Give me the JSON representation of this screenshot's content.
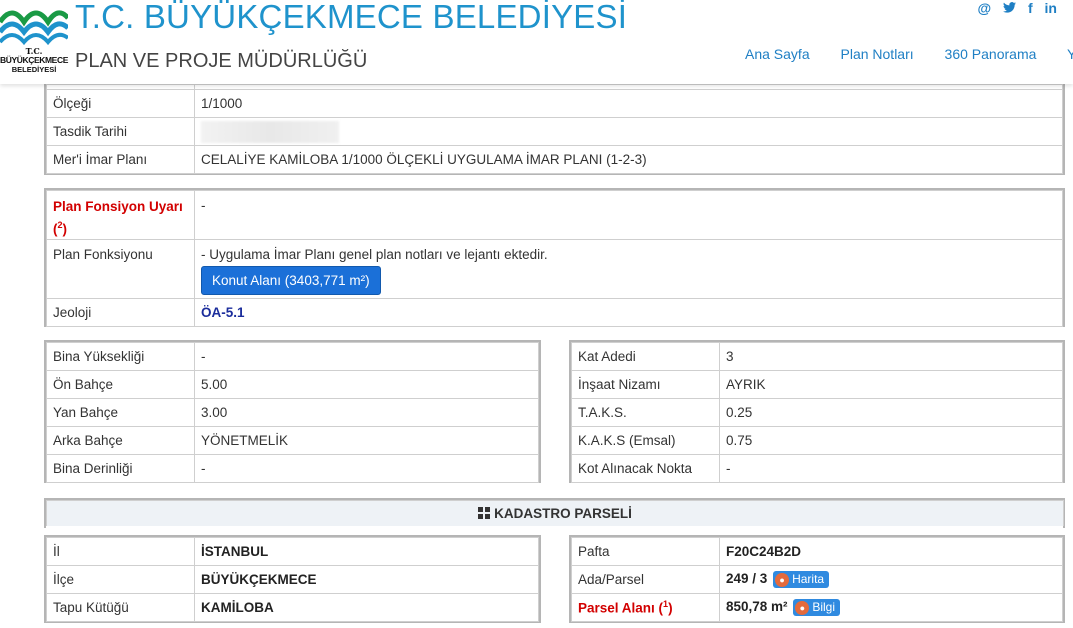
{
  "header": {
    "title": "T.C. BÜYÜKÇEKMECE BELEDİYESİ",
    "subtitle": "PLAN VE PROJE MÜDÜRLÜĞÜ",
    "logo": {
      "line1": "T.C.",
      "line2": "BÜYÜKÇEKMECE",
      "line3": "BELEDİYESİ"
    },
    "social": {
      "email": "@",
      "twitter": "twitter-icon",
      "facebook": "f",
      "linkedin": "in"
    },
    "nav": [
      "Ana Sayfa",
      "Plan Notları",
      "360 Panorama",
      "Y"
    ]
  },
  "plan_info": {
    "rows": [
      {
        "label": "Ölçeği",
        "value": "1/1000"
      },
      {
        "label": "Tasdik Tarihi",
        "value": ""
      },
      {
        "label": "Mer'i İmar Planı",
        "value": "CELALİYE KAMİLOBA 1/1000 ÖLÇEKLİ UYGULAMA İMAR PLANI (1-2-3)"
      }
    ]
  },
  "function": {
    "warning_label": "Plan Fonsiyon Uyarı",
    "warning_ref": "2",
    "warning_value": "-",
    "function_label": "Plan Fonksiyonu",
    "function_note": "- Uygulama İmar Planı genel plan notları ve lejantı ektedir.",
    "function_button": "Konut Alanı (3403,771 m²)",
    "geology_label": "Jeoloji",
    "geology_value": "ÖA-5.1"
  },
  "building_left": [
    {
      "label": "Bina Yüksekliği",
      "value": "-"
    },
    {
      "label": "Ön Bahçe",
      "value": "5.00"
    },
    {
      "label": "Yan Bahçe",
      "value": "3.00"
    },
    {
      "label": "Arka Bahçe",
      "value": "YÖNETMELİK"
    },
    {
      "label": "Bina Derinliği",
      "value": "-"
    }
  ],
  "building_right": [
    {
      "label": "Kat Adedi",
      "value": "3"
    },
    {
      "label": "İnşaat Nizamı",
      "value": "AYRIK"
    },
    {
      "label": "T.A.K.S.",
      "value": "0.25"
    },
    {
      "label": "K.A.K.S (Emsal)",
      "value": "0.75"
    },
    {
      "label": "Kot Alınacak Nokta",
      "value": "-"
    }
  ],
  "cadastre": {
    "heading": "KADASTRO PARSELİ",
    "left": [
      {
        "label": "İl",
        "value": "İSTANBUL"
      },
      {
        "label": "İlçe",
        "value": "BÜYÜKÇEKMECE"
      },
      {
        "label": "Tapu Kütüğü",
        "value": "KAMİLOBA"
      }
    ],
    "pafta_label": "Pafta",
    "pafta_value": "F20C24B2D",
    "ada_label": "Ada/Parsel",
    "ada_value": "249 / 3",
    "map_button": "Harita",
    "area_label": "Parsel Alanı",
    "area_ref": "1",
    "area_value": "850,78 m²",
    "info_button": "Bilgi"
  },
  "colors": {
    "brand_blue": "#1f93cc",
    "button_blue": "#1b70d8",
    "warning_red": "#d20000",
    "geology_blue": "#1b2d9c"
  }
}
